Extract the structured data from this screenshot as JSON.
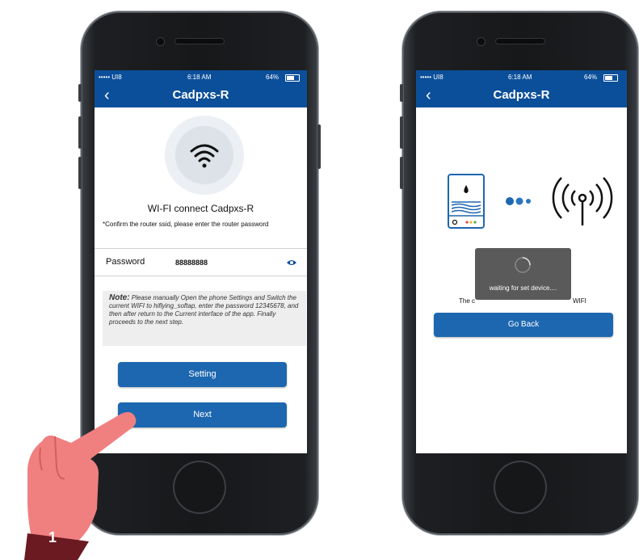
{
  "left_phone": {
    "status": {
      "carrier": "••••• UI8",
      "time": "6:18 AM",
      "battery": "64%"
    },
    "nav": {
      "back": "‹",
      "title": "Cadpxs-R"
    },
    "wifi_heading_prefix": "WI-FI connect",
    "wifi_heading_name": "Cadpxs-R",
    "instruction": "*Confirm the router ssid, please enter the router password",
    "password_label": "Password",
    "password_value": "88888888",
    "note_label": "Note:",
    "note_text": "Please manually Open the phone Settings and Switch the current WIFI to hiflying_softap, enter the password 12345678, and then after return to the Current interface of the app. Finally proceeds to the next step.",
    "setting_button": "Setting",
    "next_button": "Next"
  },
  "right_phone": {
    "status": {
      "carrier": "••••• UI8",
      "time": "6:18 AM",
      "battery": "64%"
    },
    "nav": {
      "back": "‹",
      "title": "Cadpxs-R"
    },
    "hidden_text_left": "The c",
    "hidden_text_right": "WIFI",
    "toast_text": "waiting for set device....",
    "go_back_button": "Go Back"
  },
  "step_badge": "1",
  "colors": {
    "nav": "#0b4f9a",
    "button": "#1d67b0",
    "hand": "#f08080",
    "badge": "#6b1a22",
    "device": "#1d67b0"
  }
}
